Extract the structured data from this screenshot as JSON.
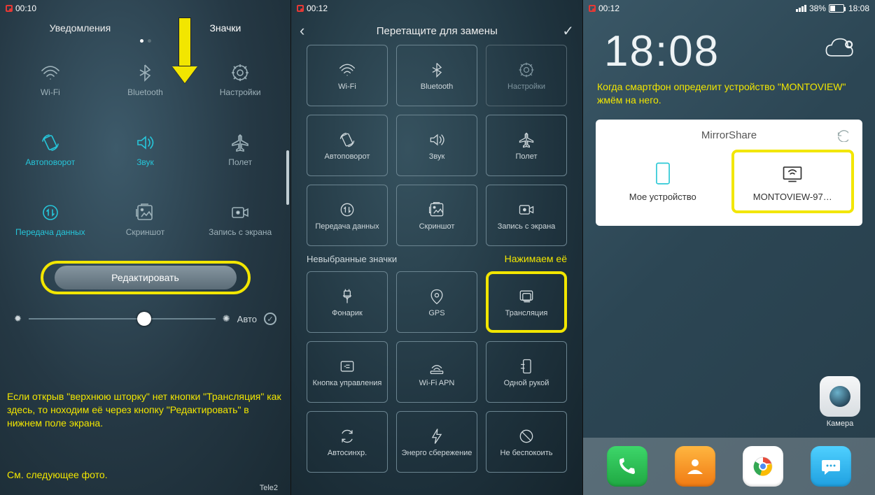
{
  "panel1": {
    "time": "00:10",
    "tabs": {
      "notifications": "Уведомления",
      "icons": "Значки"
    },
    "tiles": [
      {
        "name": "wifi",
        "label": "Wi-Fi",
        "state": "dim"
      },
      {
        "name": "bluetooth",
        "label": "Bluetooth",
        "state": "dim"
      },
      {
        "name": "settings",
        "label": "Настройки",
        "state": "dim"
      },
      {
        "name": "autorotate",
        "label": "Автоповорот",
        "state": "on"
      },
      {
        "name": "sound",
        "label": "Звук",
        "state": "on"
      },
      {
        "name": "flight",
        "label": "Полет",
        "state": "dim"
      },
      {
        "name": "data",
        "label": "Передача данных",
        "state": "on"
      },
      {
        "name": "screenshot",
        "label": "Скриншот",
        "state": "dim"
      },
      {
        "name": "screenrec",
        "label": "Запись с экрана",
        "state": "dim"
      }
    ],
    "edit_label": "Редактировать",
    "auto_label": "Авто",
    "note1": "Если открыв \"верхнюю шторку\" нет кнопки \"Трансляция\" как здесь, то ноходим её через кнопку \"Редактировать\" в нижнем поле экрана.",
    "note2": "См. следующее фото.",
    "carrier": "Tele2"
  },
  "panel2": {
    "time": "00:12",
    "title": "Перетащите для замены",
    "selected": [
      {
        "name": "wifi",
        "label": "Wi-Fi"
      },
      {
        "name": "bluetooth",
        "label": "Bluetooth"
      },
      {
        "name": "settings",
        "label": "Настройки",
        "dim": true
      },
      {
        "name": "autorotate",
        "label": "Автоповорот"
      },
      {
        "name": "sound",
        "label": "Звук"
      },
      {
        "name": "flight",
        "label": "Полет"
      },
      {
        "name": "data",
        "label": "Передача данных"
      },
      {
        "name": "screenshot",
        "label": "Скриншот"
      },
      {
        "name": "screenrec",
        "label": "Запись с экрана"
      }
    ],
    "section_label": "Невыбранные значки",
    "hint": "Нажимаем её",
    "unselected": [
      {
        "name": "flashlight",
        "label": "Фонарик"
      },
      {
        "name": "gps",
        "label": "GPS"
      },
      {
        "name": "cast",
        "label": "Трансляция",
        "hl": true
      },
      {
        "name": "navbtn",
        "label": "Кнопка управления"
      },
      {
        "name": "wifiapn",
        "label": "Wi-Fi APN"
      },
      {
        "name": "onehand",
        "label": "Одной рукой"
      },
      {
        "name": "autosync",
        "label": "Автосинхр."
      },
      {
        "name": "energy",
        "label": "Энерго сбережение"
      },
      {
        "name": "dnd",
        "label": "Не беспокоить"
      }
    ]
  },
  "panel3": {
    "rec_time": "00:12",
    "battery_pct": "38%",
    "status_time": "18:08",
    "clock": "18:08",
    "message": "Когда смартфон определит устройство \"MONTOVIEW\" жмём на него.",
    "card_title": "MirrorShare",
    "my_device": "Мое устройство",
    "found_device": "MONTOVIEW-97…",
    "camera_label": "Камера"
  }
}
